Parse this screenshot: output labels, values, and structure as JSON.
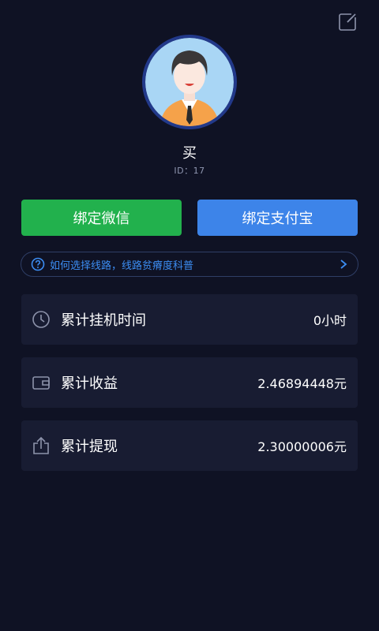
{
  "header": {
    "edit_icon": "edit-icon"
  },
  "profile": {
    "avatar_icon": "avatar-illustration",
    "name": "买",
    "id_text": "ID：17"
  },
  "actions": {
    "wechat_label": "绑定微信",
    "wechat_color": "#22b14d",
    "alipay_label": "绑定支付宝",
    "alipay_color": "#3d84e9"
  },
  "tip": {
    "text": "如何选择线路，线路贫瘠度科普",
    "icon": "question-circle-icon",
    "chevron": "chevron-right-icon",
    "color": "#3c8df2"
  },
  "stats": [
    {
      "icon": "clock-icon",
      "label": "累计挂机时间",
      "value": "0小时"
    },
    {
      "icon": "wallet-icon",
      "label": "累计收益",
      "value": "2.46894448元"
    },
    {
      "icon": "share-upload-icon",
      "label": "累计提现",
      "value": "2.30000006元"
    }
  ]
}
